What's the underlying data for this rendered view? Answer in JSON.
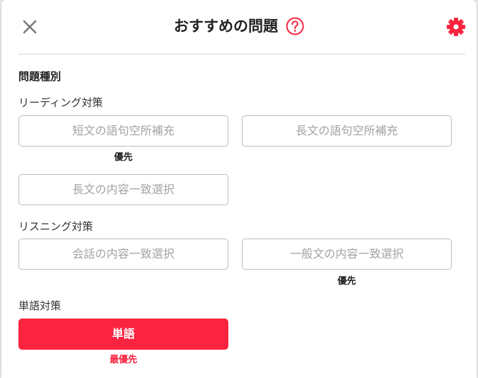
{
  "header": {
    "title": "おすすめの問題",
    "close_icon": "close-icon",
    "help_icon": "question-circle-icon",
    "settings_icon": "gear-icon"
  },
  "colors": {
    "accent": "#fb2440",
    "close_icon": "#7a7a7a",
    "option_border": "#bcbcbc",
    "option_text": "#a3a3a3"
  },
  "section": {
    "title": "問題種別"
  },
  "reading": {
    "label": "リーディング対策",
    "options": [
      {
        "label": "短文の語句空所補充",
        "priority": "優先"
      },
      {
        "label": "長文の語句空所補充"
      },
      {
        "label": "長文の内容一致選択"
      }
    ]
  },
  "listening": {
    "label": "リスニング対策",
    "options": [
      {
        "label": "会話の内容一致選択"
      },
      {
        "label": "一般文の内容一致選択",
        "priority": "優先"
      }
    ]
  },
  "vocabulary": {
    "label": "単語対策",
    "options": [
      {
        "label": "単語",
        "priority": "最優先",
        "selected": true
      }
    ]
  }
}
